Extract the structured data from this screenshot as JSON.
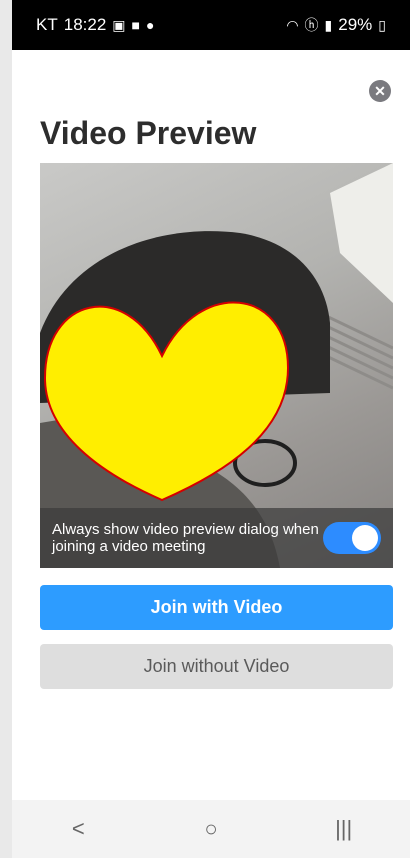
{
  "status_bar": {
    "carrier": "KT",
    "time": "18:22",
    "battery": "29%",
    "left_icons": [
      "image-icon",
      "video-icon",
      "messenger-icon"
    ],
    "right_icons": [
      "wifi-icon",
      "hd-icon",
      "signal-icon",
      "battery-icon"
    ]
  },
  "dialog": {
    "title": "Video Preview",
    "close_icon": "close-icon",
    "preview_overlay_text": "Always show video preview dialog when joining a video meeting",
    "toggle_on": true,
    "join_with_video": "Join with Video",
    "join_without_video": "Join without Video"
  },
  "colors": {
    "primary": "#2d9cff",
    "toggle": "#2d8cff",
    "secondary_button": "#dedede",
    "heart_fill": "#ffee00",
    "heart_stroke": "#d40000"
  },
  "nav_bar": {
    "back": "<",
    "home": "○",
    "recents": "|||"
  }
}
